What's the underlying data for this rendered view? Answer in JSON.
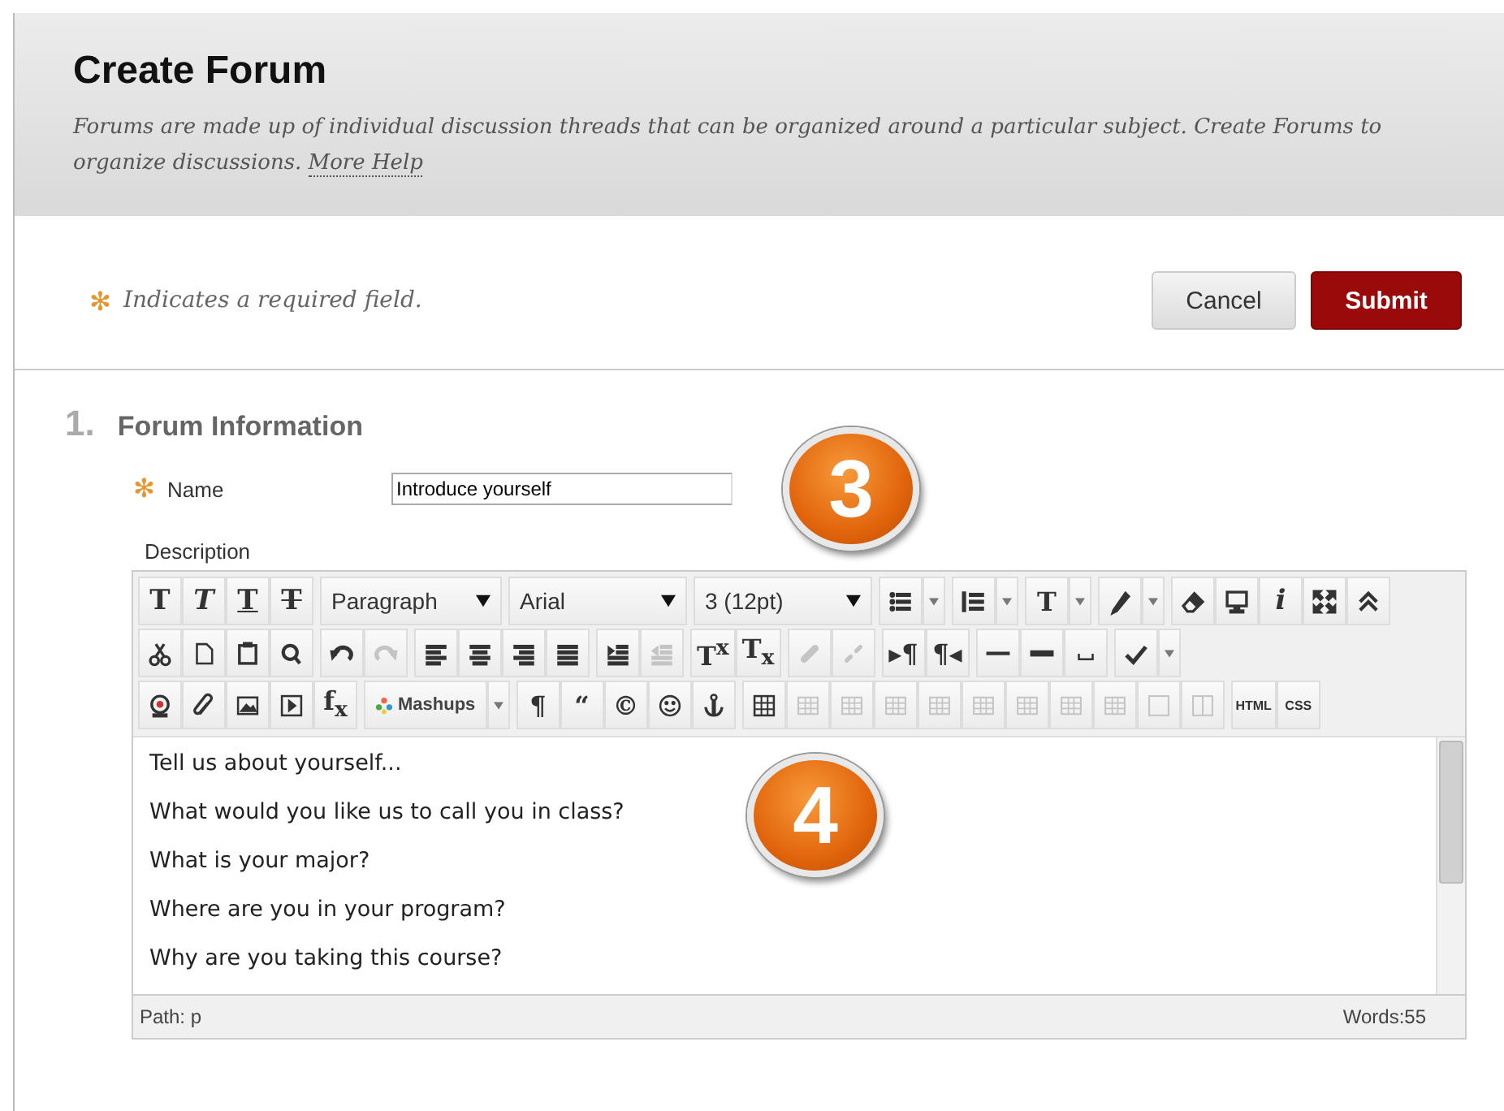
{
  "header": {
    "title": "Create Forum",
    "description": "Forums are made up of individual discussion threads that can be organized around a particular subject. Create Forums to organize discussions.",
    "help_link": "More Help"
  },
  "required_note": {
    "mark": "✻",
    "text": "Indicates a required field."
  },
  "buttons": [
    {
      "label": "Cancel",
      "kind": "secondary"
    },
    {
      "label": "Submit",
      "kind": "primary"
    }
  ],
  "section": {
    "number": "1.",
    "title": "Forum Information"
  },
  "name_field": {
    "required_mark": "✻",
    "label": "Name",
    "value": "Introduce yourself",
    "badge": "3"
  },
  "description_label": "Description",
  "editor": {
    "toolbar": [
      [
        [
          {
            "kind": "bold",
            "label": "T",
            "disabled": false
          },
          {
            "kind": "italic",
            "label": "T",
            "disabled": false
          },
          {
            "kind": "underline",
            "label": "T",
            "disabled": false
          },
          {
            "kind": "strike",
            "label": "T",
            "disabled": false
          }
        ],
        [
          {
            "kind": "select",
            "label": "Paragraph",
            "disabled": false
          }
        ],
        [
          {
            "kind": "select",
            "label": "Arial",
            "disabled": false
          }
        ],
        [
          {
            "kind": "select",
            "label": "3 (12pt)",
            "disabled": false
          }
        ],
        [
          {
            "kind": "icon",
            "disabled": false
          },
          {
            "kind": "split",
            "disabled": false
          }
        ],
        [
          {
            "kind": "icon",
            "disabled": false
          },
          {
            "kind": "split",
            "disabled": false
          }
        ],
        [
          {
            "kind": "glyph",
            "label": "T",
            "disabled": false
          },
          {
            "kind": "split",
            "disabled": false
          }
        ],
        [
          {
            "kind": "icon",
            "disabled": false
          },
          {
            "kind": "split",
            "disabled": false
          }
        ],
        [
          {
            "kind": "icon",
            "disabled": false
          },
          {
            "kind": "icon",
            "disabled": false
          },
          {
            "kind": "italic",
            "label": "i",
            "disabled": false
          },
          {
            "kind": "icon",
            "disabled": false
          },
          {
            "kind": "icon",
            "disabled": false
          }
        ]
      ],
      [
        [
          {
            "kind": "icon",
            "disabled": false
          },
          {
            "kind": "icon",
            "disabled": false
          },
          {
            "kind": "icon",
            "disabled": false
          },
          {
            "kind": "icon",
            "disabled": false
          }
        ],
        [
          {
            "kind": "icon",
            "disabled": false
          },
          {
            "kind": "icon",
            "disabled": true
          }
        ],
        [
          {
            "kind": "icon",
            "disabled": false
          },
          {
            "kind": "icon",
            "disabled": false
          },
          {
            "kind": "icon",
            "disabled": false
          },
          {
            "kind": "icon",
            "disabled": false
          }
        ],
        [
          {
            "kind": "icon",
            "disabled": false
          },
          {
            "kind": "icon",
            "disabled": true
          }
        ],
        [
          {
            "kind": "glyph",
            "label": "T$^{x}$",
            "disabled": false
          },
          {
            "kind": "glyph",
            "label": "T$_{x}$",
            "disabled": false
          }
        ],
        [
          {
            "kind": "icon",
            "disabled": true
          },
          {
            "kind": "icon",
            "disabled": true
          }
        ],
        [
          {
            "kind": "glyph",
            "label": "▸¶",
            "disabled": false
          },
          {
            "kind": "glyph",
            "label": "¶◂",
            "disabled": false
          }
        ],
        [
          {
            "kind": "icon",
            "disabled": false
          },
          {
            "kind": "icon",
            "disabled": false
          },
          {
            "kind": "icon",
            "disabled": false
          }
        ],
        [
          {
            "kind": "icon",
            "disabled": false
          },
          {
            "kind": "split",
            "disabled": false
          }
        ]
      ],
      [
        [
          {
            "kind": "icon",
            "disabled": false
          },
          {
            "kind": "icon",
            "disabled": false
          },
          {
            "kind": "icon",
            "disabled": false
          },
          {
            "kind": "icon",
            "disabled": false
          },
          {
            "kind": "glyph",
            "label": "f$_{x}$",
            "disabled": false
          }
        ],
        [
          {
            "kind": "labeled",
            "label": "Mashups",
            "disabled": false
          },
          {
            "kind": "split",
            "disabled": false
          }
        ],
        [
          {
            "kind": "glyph",
            "label": "¶",
            "disabled": false
          },
          {
            "kind": "glyph",
            "label": "“",
            "disabled": false
          },
          {
            "kind": "glyph",
            "label": "©",
            "disabled": false
          },
          {
            "kind": "icon",
            "disabled": false
          },
          {
            "kind": "icon",
            "disabled": false
          }
        ],
        [
          {
            "kind": "icon",
            "disabled": false
          },
          {
            "kind": "icon",
            "disabled": true
          },
          {
            "kind": "icon",
            "disabled": true
          },
          {
            "kind": "icon",
            "disabled": true
          },
          {
            "kind": "icon",
            "disabled": true
          },
          {
            "kind": "icon",
            "disabled": true
          },
          {
            "kind": "icon",
            "disabled": true
          },
          {
            "kind": "icon",
            "disabled": true
          },
          {
            "kind": "icon",
            "disabled": true
          },
          {
            "kind": "icon",
            "disabled": true
          },
          {
            "kind": "icon",
            "disabled": true
          }
        ],
        [
          {
            "kind": "code",
            "label": "HTML",
            "disabled": false
          },
          {
            "kind": "code",
            "label": "CSS",
            "disabled": false
          }
        ]
      ]
    ],
    "content": [
      "Tell us about yourself...",
      "What would you like us to call you in class?",
      "What is your major?",
      "Where are you in your program?",
      "Why are you taking this course?"
    ],
    "badge": "4",
    "path": "Path: p",
    "word_count": "Words:55"
  }
}
